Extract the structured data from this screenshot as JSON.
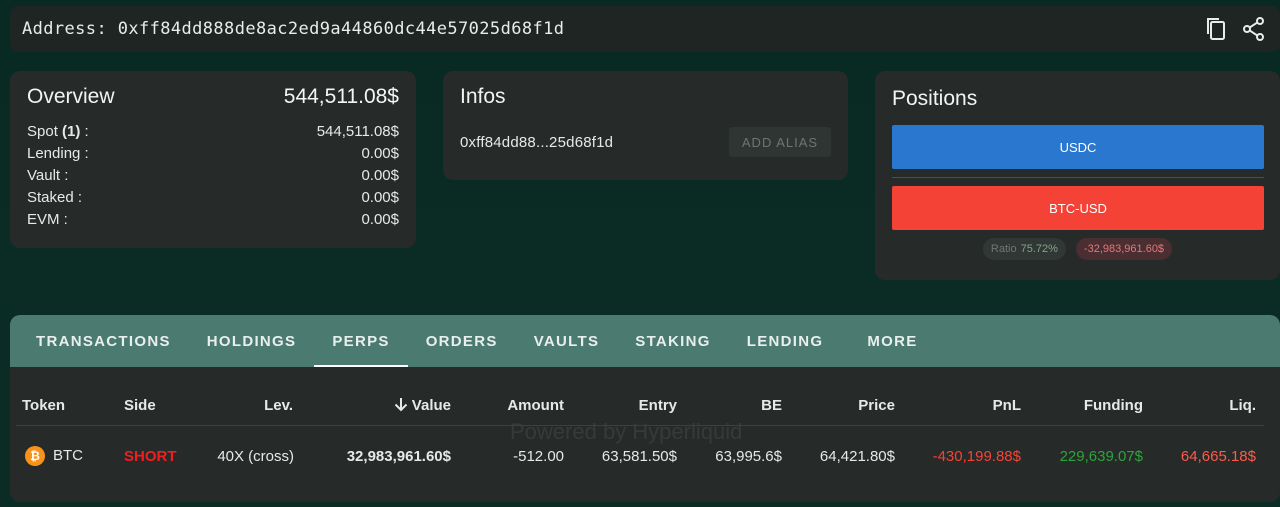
{
  "address_bar": {
    "label": "Address: 0xff84dd888de8ac2ed9a44860dc44e57025d68f1d",
    "copy_icon": "copy-icon",
    "share_icon": "share-icon"
  },
  "overview": {
    "title": "Overview",
    "total": "544,511.08$",
    "rows": [
      {
        "label_pre": "Spot ",
        "label_bold": "(1)",
        "label_post": " :",
        "value": "544,511.08$"
      },
      {
        "label": "Lending :",
        "value": "0.00$"
      },
      {
        "label": "Vault :",
        "value": "0.00$"
      },
      {
        "label": "Staked :",
        "value": "0.00$"
      },
      {
        "label": "EVM :",
        "value": "0.00$"
      }
    ]
  },
  "infos": {
    "title": "Infos",
    "short_address": "0xff84dd88...25d68f1d",
    "add_alias": "ADD ALIAS"
  },
  "positions": {
    "title": "Positions",
    "usdc_label": "USDC",
    "btc_label": "BTC-USD",
    "ratio_label": "Ratio",
    "ratio_value": "75.72%",
    "net_value": "-32,983,961.60$",
    "colors": {
      "usdc": "#2a77d0",
      "btc": "#f44336"
    }
  },
  "tabs": [
    {
      "label": "TRANSACTIONS",
      "active": false
    },
    {
      "label": "HOLDINGS",
      "active": false
    },
    {
      "label": "PERPS",
      "active": true
    },
    {
      "label": "ORDERS",
      "active": false
    },
    {
      "label": "VAULTS",
      "active": false
    },
    {
      "label": "STAKING",
      "active": false
    },
    {
      "label": "LENDING",
      "active": false
    },
    {
      "label": "MORE",
      "active": false
    }
  ],
  "table": {
    "headers": {
      "token": "Token",
      "side": "Side",
      "lev": "Lev.",
      "value": "Value",
      "amount": "Amount",
      "entry": "Entry",
      "be": "BE",
      "price": "Price",
      "pnl": "PnL",
      "funding": "Funding",
      "liq": "Liq."
    },
    "sort_icon": "arrow-down-icon",
    "watermark": "Powered by Hyperliquid",
    "rows": [
      {
        "token_icon": "bitcoin-icon",
        "token": "BTC",
        "side": "SHORT",
        "lev": "40X (cross)",
        "value": "32,983,961.60$",
        "amount": "-512.00",
        "entry": "63,581.50$",
        "be": "63,995.6$",
        "price": "64,421.80$",
        "pnl": "-430,199.88$",
        "funding": "229,639.07$",
        "liq": "64,665.18$"
      }
    ]
  }
}
